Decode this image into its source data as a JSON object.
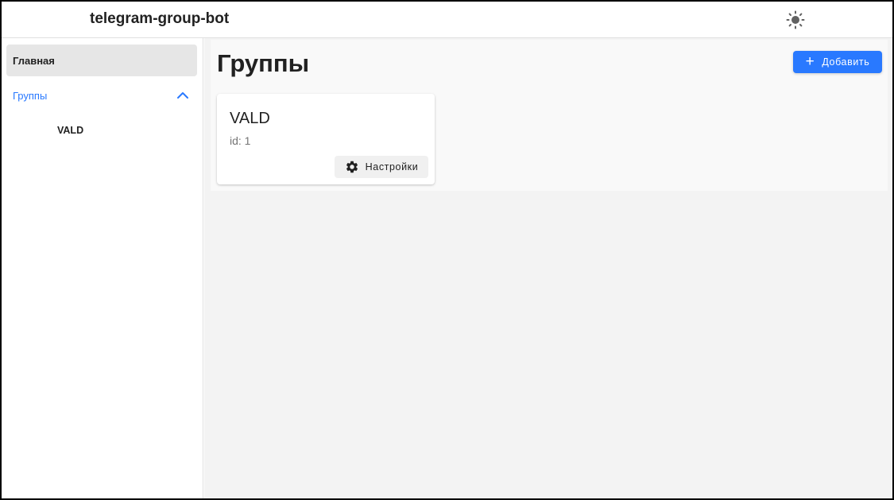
{
  "header": {
    "app_title": "telegram-group-bot",
    "theme_icon": "sun-icon"
  },
  "sidebar": {
    "items": [
      {
        "label": "Главная",
        "active": true
      },
      {
        "label": "Группы",
        "expanded": true,
        "color": "#2979ff"
      },
      {
        "label": "VALD",
        "child": true
      }
    ]
  },
  "main": {
    "title": "Группы",
    "add_button": {
      "label": "Добавить",
      "icon": "plus-icon",
      "color": "#2979ff"
    },
    "cards": [
      {
        "name": "VALD",
        "id_text": "id: 1",
        "settings_button": {
          "label": "Настройки",
          "icon": "gear-icon"
        }
      }
    ]
  }
}
